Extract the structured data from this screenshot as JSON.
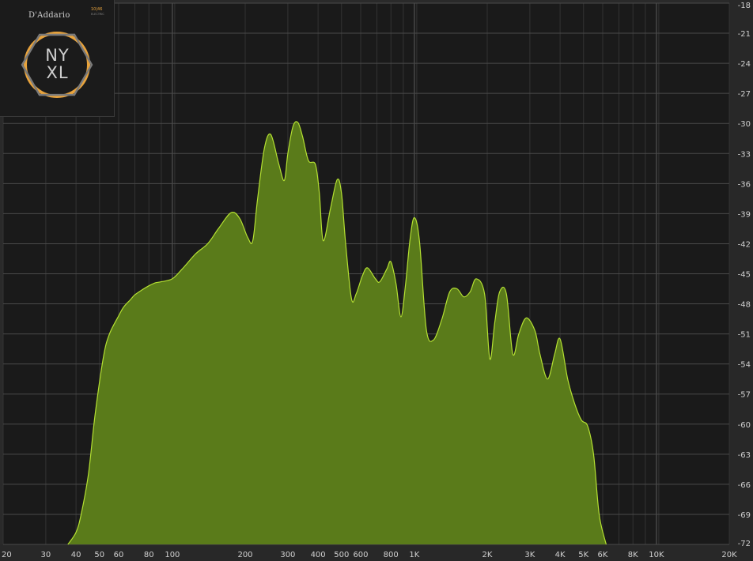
{
  "logo": {
    "brand": "D'Addario",
    "gauge": "10|46",
    "sub": "ELECTRIC",
    "line1": "NY",
    "line2": "XL",
    "ring_color": "#e8a33c"
  },
  "colors": {
    "plot_background": "#1a1a1a",
    "grid_major": "#4a4a4a",
    "grid_minor": "#333333",
    "fill": "#5a7b1a",
    "stroke": "#b4e032",
    "frame": "#2a2a2a"
  },
  "chart_data": {
    "type": "area",
    "x_scale": "log",
    "xlim": [
      20,
      20000
    ],
    "ylim": [
      -72,
      -18
    ],
    "xlabel": "",
    "ylabel": "",
    "grid": true,
    "x_tick_labels": [
      {
        "value": 20,
        "label": "20"
      },
      {
        "value": 30,
        "label": "30"
      },
      {
        "value": 40,
        "label": "40"
      },
      {
        "value": 50,
        "label": "50"
      },
      {
        "value": 60,
        "label": "60"
      },
      {
        "value": 80,
        "label": "80"
      },
      {
        "value": 100,
        "label": "100"
      },
      {
        "value": 200,
        "label": "200"
      },
      {
        "value": 300,
        "label": "300"
      },
      {
        "value": 400,
        "label": "400"
      },
      {
        "value": 500,
        "label": "500"
      },
      {
        "value": 600,
        "label": "600"
      },
      {
        "value": 800,
        "label": "800"
      },
      {
        "value": 1000,
        "label": "1K"
      },
      {
        "value": 2000,
        "label": "2K"
      },
      {
        "value": 3000,
        "label": "3K"
      },
      {
        "value": 4000,
        "label": "4K"
      },
      {
        "value": 5000,
        "label": "5K"
      },
      {
        "value": 6000,
        "label": "6K"
      },
      {
        "value": 8000,
        "label": "8K"
      },
      {
        "value": 10000,
        "label": "10K"
      },
      {
        "value": 20000,
        "label": "20K"
      }
    ],
    "y_tick_labels": [
      "-18",
      "-21",
      "-24",
      "-27",
      "-30",
      "-33",
      "-36",
      "-39",
      "-42",
      "-45",
      "-48",
      "-51",
      "-54",
      "-57",
      "-60",
      "-63",
      "-66",
      "-69",
      "-72"
    ],
    "series": [
      {
        "x": [
          37,
          40,
          42,
          45,
          48,
          52,
          55,
          60,
          63,
          67,
          70,
          75,
          80,
          85,
          90,
          100,
          110,
          125,
          140,
          155,
          175,
          190,
          205,
          215,
          225,
          240,
          255,
          275,
          290,
          300,
          315,
          330,
          345,
          365,
          390,
          405,
          420,
          450,
          480,
          500,
          520,
          550,
          575,
          610,
          640,
          690,
          720,
          770,
          800,
          840,
          880,
          920,
          960,
          1000,
          1050,
          1120,
          1200,
          1300,
          1400,
          1500,
          1600,
          1700,
          1800,
          1950,
          2050,
          2150,
          2250,
          2400,
          2550,
          2700,
          2900,
          3150,
          3300,
          3550,
          3800,
          4000,
          4300,
          4600,
          4900,
          5200,
          5500,
          5800,
          6200
        ],
        "y": [
          -72,
          -70.8,
          -69,
          -65,
          -59,
          -53.2,
          -51,
          -49.2,
          -48.3,
          -47.6,
          -47.1,
          -46.6,
          -46.2,
          -45.9,
          -45.8,
          -45.5,
          -44.5,
          -43,
          -42,
          -40.5,
          -38.9,
          -39.5,
          -41.4,
          -41.7,
          -37.5,
          -32.5,
          -31.1,
          -34,
          -35.7,
          -33,
          -30.3,
          -29.9,
          -31.3,
          -33.7,
          -34.1,
          -37,
          -41.7,
          -38.5,
          -35.6,
          -37,
          -42,
          -47.5,
          -47,
          -45.2,
          -44.4,
          -45.5,
          -45.8,
          -44.5,
          -43.8,
          -46,
          -49.3,
          -46,
          -41.5,
          -39.4,
          -41.8,
          -50.5,
          -51.6,
          -49.5,
          -46.8,
          -46.5,
          -47.3,
          -46.8,
          -45.5,
          -47,
          -53.5,
          -49.8,
          -46.8,
          -47,
          -53,
          -51,
          -49.4,
          -50.7,
          -53,
          -55.5,
          -53,
          -51.5,
          -55.5,
          -58,
          -59.6,
          -60.2,
          -63,
          -69,
          -72
        ]
      }
    ]
  }
}
